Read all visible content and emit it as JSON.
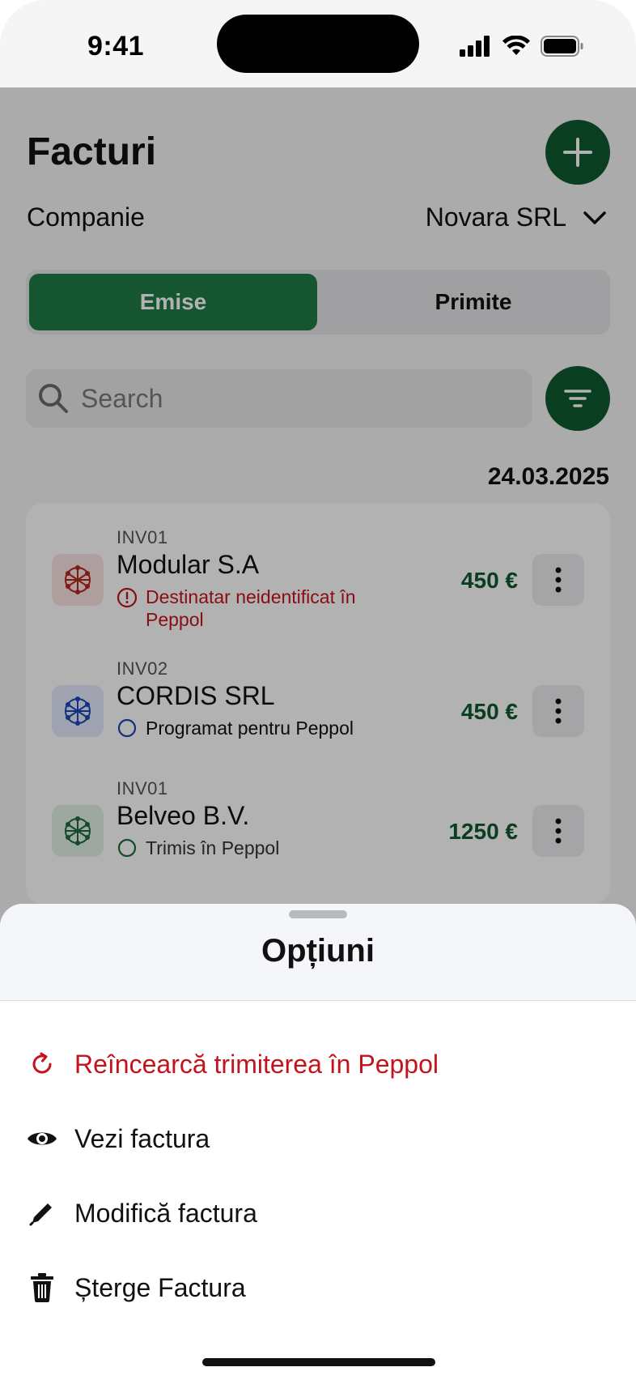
{
  "status_bar": {
    "time": "9:41"
  },
  "header": {
    "title": "Facturi"
  },
  "company": {
    "label": "Companie",
    "selected": "Novara SRL"
  },
  "tabs": [
    {
      "label": "Emise",
      "active": true
    },
    {
      "label": "Primite",
      "active": false
    }
  ],
  "search": {
    "placeholder": "Search"
  },
  "list": {
    "date": "24.03.2025",
    "invoices": [
      {
        "number": "INV01",
        "name": "Modular S.A",
        "status": "Destinatar neidentificat în Peppol",
        "amount": "450 €",
        "status_color": "#c4131c",
        "icon_color": "#b3261e"
      },
      {
        "number": "INV02",
        "name": "CORDIS SRL",
        "status": "Programat pentru Peppol",
        "amount": "450 €",
        "status_color": "#111111",
        "icon_color": "#1a47b8"
      },
      {
        "number": "INV01",
        "name": "Belveo B.V.",
        "status": "Trimis în Peppol",
        "amount": "1250 €",
        "status_color": "#333333",
        "icon_color": "#1f6b3a"
      }
    ]
  },
  "sheet": {
    "title": "Opțiuni",
    "options": [
      {
        "label": "Reîncearcă trimiterea în Peppol",
        "icon": "retry-icon",
        "danger": true
      },
      {
        "label": "Vezi factura",
        "icon": "eye-icon",
        "danger": false
      },
      {
        "label": "Modifică factura",
        "icon": "pencil-icon",
        "danger": false
      },
      {
        "label": "Șterge Factura",
        "icon": "trash-icon",
        "danger": false
      }
    ]
  },
  "colors": {
    "primary": "#0f5a30",
    "primary_active": "#1f7a45",
    "danger": "#c4131c",
    "overlay": "rgba(0,0,0,0.30)"
  }
}
